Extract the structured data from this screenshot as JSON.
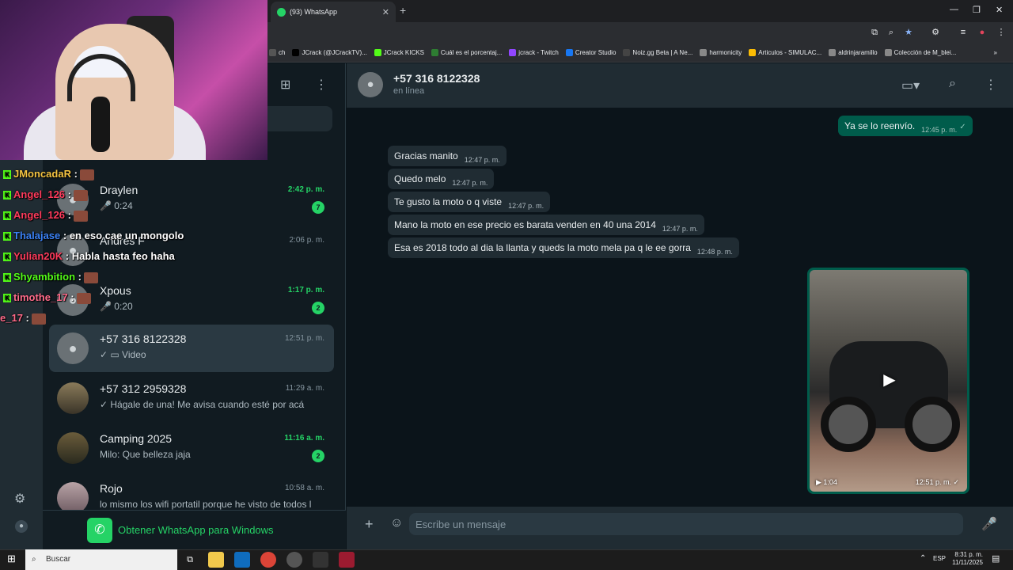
{
  "browser": {
    "tab_title": "(93) WhatsApp",
    "new_tab_symbol": "+",
    "bookmarks": [
      {
        "label": "ch",
        "color": "#555555"
      },
      {
        "label": "JCrack (@JCrackTV)...",
        "color": "#000000"
      },
      {
        "label": "JCrack KICKS",
        "color": "#53fc18"
      },
      {
        "label": "Cuál es el porcentaj...",
        "color": "#2e7d32"
      },
      {
        "label": "jcrack - Twitch",
        "color": "#9146ff"
      },
      {
        "label": "Creator Studio",
        "color": "#1877f2"
      },
      {
        "label": "Noiz.gg Beta | A Ne...",
        "color": "#111111"
      },
      {
        "label": "harmonicity",
        "color": "#e8eaed"
      },
      {
        "label": "Articulos - SIMULAC...",
        "color": "#fbbc04"
      },
      {
        "label": "aldrinjaramillo",
        "color": "#e8eaed"
      },
      {
        "label": "Colección de M_blei...",
        "color": "#e8eaed"
      }
    ],
    "more_bookmarks": "»"
  },
  "twitch_chat": [
    {
      "user": "JModadaR",
      "user_display": "JMoncadaR",
      "color": "#f5c542",
      "msg": ""
    },
    {
      "user_display": "Angel_126",
      "color": "#ff3b5c",
      "msg": ""
    },
    {
      "user_display": "Angel_126",
      "color": "#ff3b5c",
      "msg": ""
    },
    {
      "user_display": "Thalajase",
      "color": "#3b82f6",
      "msg": "en eso cae un mongolo"
    },
    {
      "user_display": "Yulian20K",
      "color": "#ff3b5c",
      "msg": "Habla hasta feo haha"
    },
    {
      "user_display": "Shyambition",
      "color": "#53fc18",
      "msg": ""
    },
    {
      "user_display": "timothe_17",
      "color": "#ff6b8a",
      "msg": ""
    },
    {
      "user_display": "e_17",
      "color": "#ff6b8a",
      "msg": ""
    }
  ],
  "sidebar": {
    "new_chat_icon": "⊞",
    "menu_icon": "⋮",
    "chats": [
      {
        "name": "Draylen",
        "time": "2:42 p. m.",
        "preview": "🎤 0:24",
        "badge": "7",
        "unread": true
      },
      {
        "name": "Andres F",
        "time": "2:06 p. m.",
        "preview": "",
        "badge": "",
        "unread": false
      },
      {
        "name": "Xpous",
        "time": "1:17 p. m.",
        "preview": "🎤 0:20",
        "badge": "2",
        "unread": true
      },
      {
        "name": "+57 316 8122328",
        "time": "12:51 p. m.",
        "preview": "✓ ▭ Video",
        "badge": "",
        "unread": false
      },
      {
        "name": "+57 312 2959328",
        "time": "11:29 a. m.",
        "preview": "✓ Hágale de una! Me avisa cuando esté por acá",
        "badge": "",
        "unread": false
      },
      {
        "name": "Camping 2025",
        "time": "11:16 a. m.",
        "preview": "Milo: Que belleza jaja",
        "badge": "2",
        "unread": true
      },
      {
        "name": "Rojo",
        "time": "10:58 a. m.",
        "preview": "lo mismo los wifi portatil porque he visto de todos l",
        "badge": "",
        "unread": false
      }
    ],
    "get_app_label": "Obtener WhatsApp para Windows"
  },
  "chat": {
    "contact_name": "+57 316 8122328",
    "status": "en línea",
    "messages": [
      {
        "dir": "out",
        "text": "Ya se lo reenvío.",
        "time": "12:45 p. m."
      },
      {
        "dir": "in",
        "text": "Gracias manito",
        "time": "12:47 p. m."
      },
      {
        "dir": "in",
        "text": "Quedo melo",
        "time": "12:47 p. m."
      },
      {
        "dir": "in",
        "text": "Te gusto la moto o q viste",
        "time": "12:47 p. m."
      },
      {
        "dir": "in",
        "text": "Mano la moto en ese precio es barata venden en 40 una 2014",
        "time": "12:47 p. m."
      },
      {
        "dir": "in",
        "text": "Esa es 2018 todo al dia la llanta y queds la moto mela pa q le ee gorra",
        "time": "12:48 p. m."
      }
    ],
    "video": {
      "duration": "1:04",
      "time": "12:51 p. m."
    },
    "composer_placeholder": "Escribe un mensaje"
  },
  "taskbar": {
    "search_placeholder": "Buscar",
    "lang": "ESP",
    "time": "8:31 p. m.",
    "date": "11/11/2025"
  }
}
